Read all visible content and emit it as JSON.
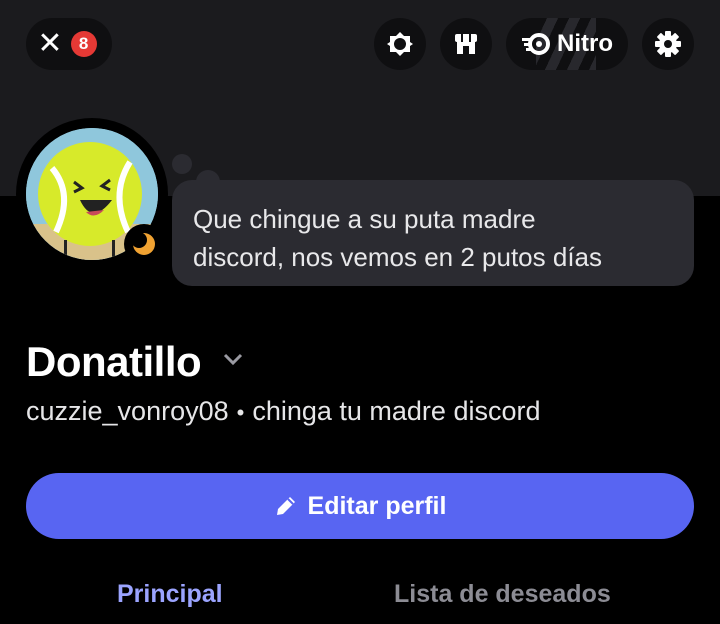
{
  "header": {
    "notification_count": "8",
    "nitro_label": "Nitro"
  },
  "profile": {
    "status_text_line1": "Que chingue a su puta madre",
    "status_text_line2": "discord, nos vemos en 2 putos días",
    "display_name": "Donatillo",
    "username": "cuzzie_vonroy08",
    "pronouns_or_tagline": "chinga tu madre discord",
    "status": "idle"
  },
  "actions": {
    "edit_profile_label": "Editar perfil"
  },
  "tabs": [
    {
      "label": "Principal",
      "active": true
    },
    {
      "label": "Lista de deseados",
      "active": false
    }
  ],
  "colors": {
    "accent": "#5865f2",
    "active_tab": "#9ba4ff",
    "badge": "#e53935",
    "idle_status": "#f0a232"
  },
  "icons": {
    "close": "close-icon",
    "boost": "server-boost-icon",
    "shop": "shop-icon",
    "nitro": "nitro-icon",
    "settings": "gear-icon",
    "edit": "pencil-icon",
    "chevron": "chevron-down-icon"
  }
}
